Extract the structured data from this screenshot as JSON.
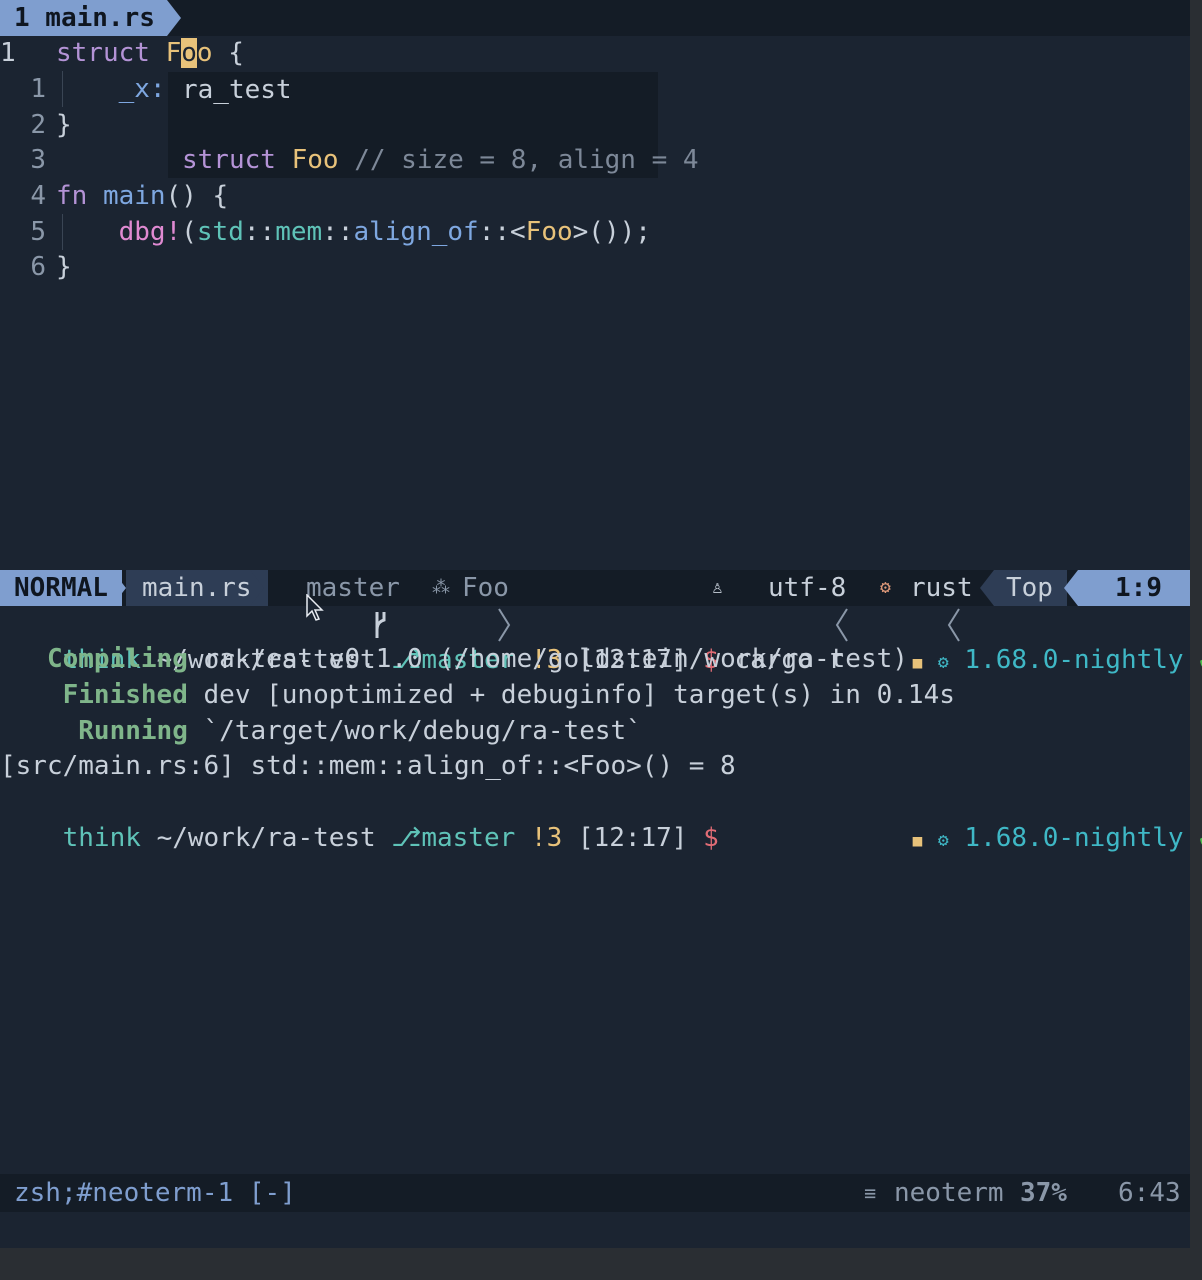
{
  "tabline": {
    "tab_label": "1 main.rs"
  },
  "editor": {
    "lines": [
      {
        "num": "1",
        "parts": [
          {
            "t": "struct ",
            "c": "kw"
          },
          {
            "t": "F",
            "c": "ty"
          },
          {
            "t": "o",
            "c": "cursor"
          },
          {
            "t": "o",
            "c": "ty"
          },
          {
            "t": " {",
            "c": "pl"
          }
        ]
      },
      {
        "num": "1",
        "parts": [
          {
            "t": "    _x: ",
            "c": "fn"
          }
        ]
      },
      {
        "num": "2",
        "parts": [
          {
            "t": "}",
            "c": "pl"
          }
        ]
      },
      {
        "num": "3",
        "parts": []
      },
      {
        "num": "4",
        "parts": [
          {
            "t": "fn ",
            "c": "kw"
          },
          {
            "t": "main",
            "c": "fn"
          },
          {
            "t": "() {",
            "c": "pl"
          }
        ]
      },
      {
        "num": "5",
        "parts": [
          {
            "t": "    ",
            "c": "pl"
          },
          {
            "t": "dbg!",
            "c": "mac"
          },
          {
            "t": "(",
            "c": "pl"
          },
          {
            "t": "std",
            "c": "teal"
          },
          {
            "t": "::",
            "c": "pl"
          },
          {
            "t": "mem",
            "c": "teal"
          },
          {
            "t": "::",
            "c": "pl"
          },
          {
            "t": "align_of",
            "c": "fn"
          },
          {
            "t": "::<",
            "c": "pl"
          },
          {
            "t": "Foo",
            "c": "ty"
          },
          {
            "t": ">());",
            "c": "pl"
          }
        ]
      },
      {
        "num": "6",
        "parts": [
          {
            "t": "}",
            "c": "pl"
          }
        ]
      }
    ]
  },
  "hover_popup": {
    "crate": "ra_test",
    "sig_kw": "struct",
    "sig_name": "Foo",
    "sig_comment": "// size = 8, align = 4"
  },
  "statusline": {
    "mode": "NORMAL",
    "filename": "main.rs",
    "branch": "master",
    "symbol": "Foo",
    "encoding": "utf-8",
    "filetype": "rust",
    "position_label": "Top",
    "cursor_pos": "1:9"
  },
  "terminal": {
    "prompt1": {
      "host": "think",
      "path": "~/work/ra-test",
      "branch": "master",
      "status": "!3",
      "time": "[12:17]",
      "dollar": "$",
      "cmd": "cargo r",
      "toolchain": "1.68.0-nightly"
    },
    "output": [
      {
        "label": "Compiling",
        "text": "ra-test v0.1.0 (/home/goldstein/work/ra-test)"
      },
      {
        "label": "Finished",
        "text": "dev [unoptimized + debuginfo] target(s) in 0.14s"
      },
      {
        "label": "Running",
        "text": "`/target/work/debug/ra-test`"
      }
    ],
    "dbg_line": "[src/main.rs:6] std::mem::align_of::<Foo>() = 8",
    "prompt2": {
      "host": "think",
      "path": "~/work/ra-test",
      "branch": "master",
      "status": "!3",
      "time": "[12:17]",
      "dollar": "$",
      "toolchain": "1.68.0-nightly"
    }
  },
  "bottombar": {
    "term_name": "zsh;#neoterm-1 [-]",
    "plugin": "neoterm",
    "percent": "37%",
    "pos": "6:43"
  },
  "colors": {
    "accent": "#7f9ecf",
    "bg": "#1b2431",
    "bar": "#141c26"
  }
}
